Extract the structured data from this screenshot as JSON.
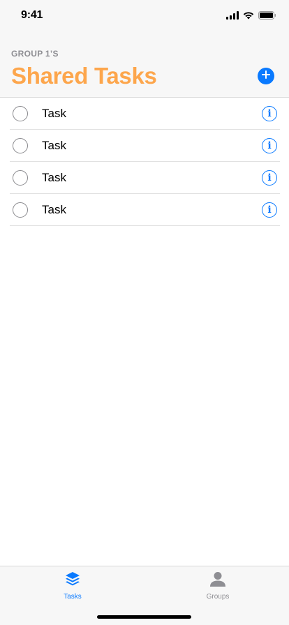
{
  "status_bar": {
    "time": "9:41"
  },
  "header": {
    "group_label": "GROUP 1’S",
    "title": "Shared Tasks",
    "add_icon": "plus-circle-icon"
  },
  "tasks": [
    {
      "label": "Task",
      "info_glyph": "i"
    },
    {
      "label": "Task",
      "info_glyph": "i"
    },
    {
      "label": "Task",
      "info_glyph": "i"
    },
    {
      "label": "Task",
      "info_glyph": "i"
    }
  ],
  "tab_bar": {
    "tabs": [
      {
        "label": "Tasks",
        "icon": "stack-icon",
        "selected": true
      },
      {
        "label": "Groups",
        "icon": "person-icon",
        "selected": false
      }
    ]
  },
  "colors": {
    "accent": "#0a7aff",
    "title": "#fda64c",
    "muted": "#8e8e93"
  }
}
